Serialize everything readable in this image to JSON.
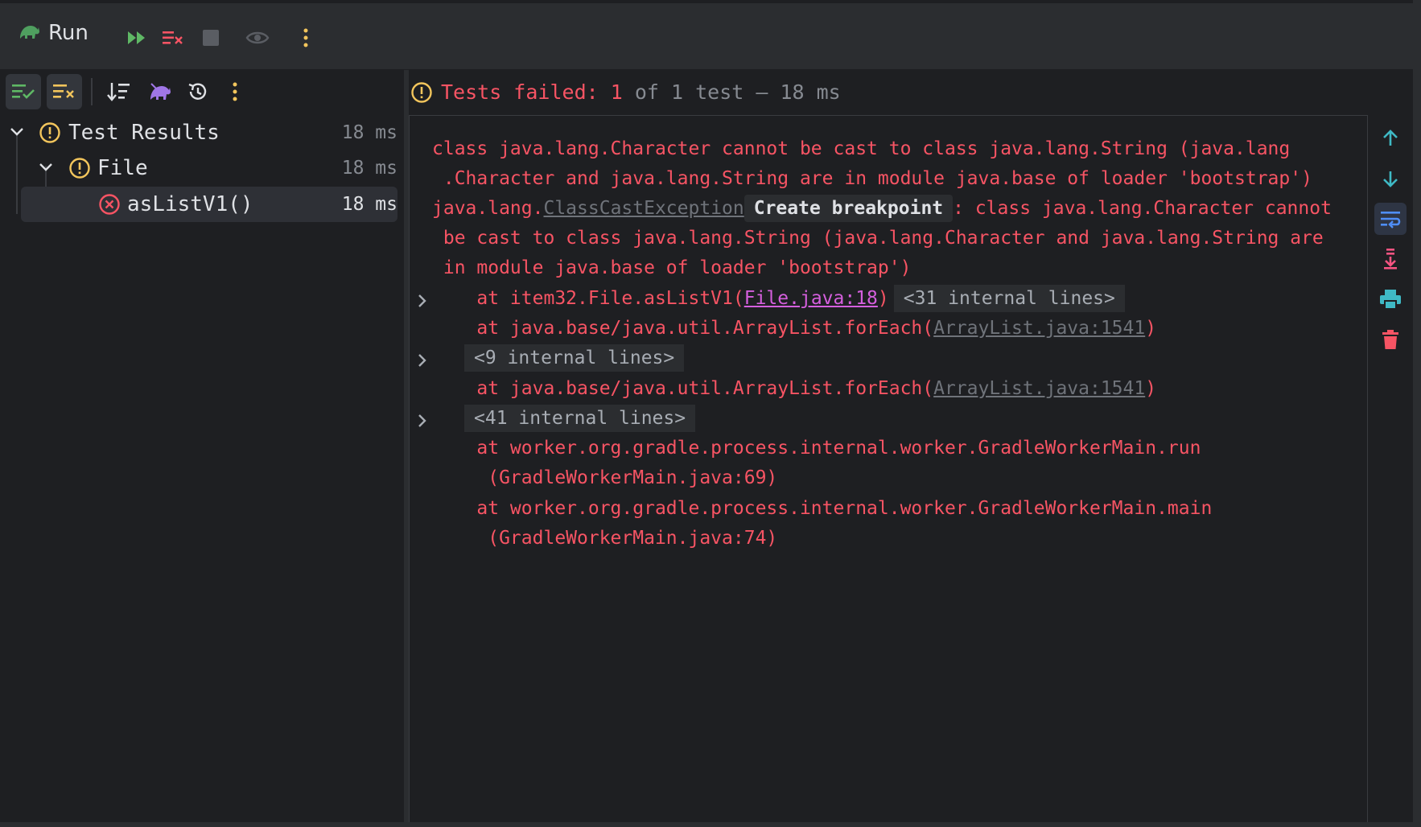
{
  "toolbar": {
    "run_label": "Run",
    "icons": [
      "gradle-run-icon",
      "rerun-icon",
      "rerun-failed-icon",
      "stop-icon",
      "eye-icon",
      "more-icon"
    ]
  },
  "left_toolbar": {
    "icons": [
      "show-passed-icon",
      "show-ignored-icon",
      "sort-icon",
      "gradle-icon",
      "history-icon",
      "more-icon"
    ]
  },
  "tree": [
    {
      "name": "Test Results",
      "duration": "18 ms",
      "status": "warning"
    },
    {
      "name": "File",
      "duration": "18 ms",
      "status": "warning"
    },
    {
      "name": "asListV1()",
      "duration": "18 ms",
      "status": "failed"
    }
  ],
  "status": {
    "prefix": "Tests failed: ",
    "failed": "1",
    "suffix": " of 1 test",
    "sep": " – ",
    "duration": "18 ms"
  },
  "console": {
    "line1": "class java.lang.Character cannot be cast to class java.lang.String (java.lang",
    "line2": " .Character and java.lang.String are in module java.base of loader 'bootstrap')",
    "line3_pre": "java.lang.",
    "line3_link": "ClassCastException",
    "line3_badge": "Create breakpoint",
    "line3_post": ": class java.lang.Character cannot",
    "line4": " be cast to class java.lang.String (java.lang.Character and java.lang.String are",
    "line5": " in module java.base of loader 'bootstrap')",
    "line6_pre": "    at item32.File.asListV1(",
    "line6_link": "File.java:18",
    "line6_post": ")",
    "line6_fold": "<31 internal lines>",
    "line7_pre": "    at java.base/java.util.ArrayList.forEach(",
    "line7_link": "ArrayList.java:1541",
    "line7_post": ")",
    "line8_fold": "<9 internal lines>",
    "line9_pre": "    at java.base/java.util.ArrayList.forEach(",
    "line9_link": "ArrayList.java:1541",
    "line9_post": ")",
    "line10_fold": "<41 internal lines>",
    "line11": "    at worker.org.gradle.process.internal.worker.GradleWorkerMain.run",
    "line12": "     (GradleWorkerMain.java:69)",
    "line13": "    at worker.org.gradle.process.internal.worker.GradleWorkerMain.main",
    "line14": "     (GradleWorkerMain.java:74)"
  },
  "side_icons": [
    "arrow-up-icon",
    "arrow-down-icon",
    "soft-wrap-icon",
    "scroll-to-end-icon",
    "print-icon",
    "trash-icon"
  ],
  "colors": {
    "error": "#f75464",
    "warning": "#f2c55c",
    "accent": "#3fb9c5",
    "link_pink": "#d55fde"
  }
}
